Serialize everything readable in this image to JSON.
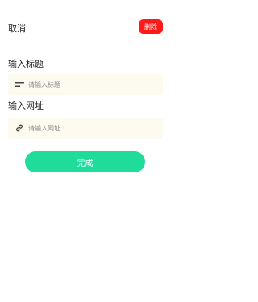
{
  "header": {
    "cancel_label": "取消",
    "delete_label": "删除"
  },
  "title_section": {
    "label": "输入标题",
    "placeholder": "请输入标题",
    "value": ""
  },
  "url_section": {
    "label": "输入网址",
    "placeholder": "请输入网址",
    "value": ""
  },
  "done_label": "完成",
  "colors": {
    "delete_button": "#ff1a1a",
    "done_button": "#1fdc9b",
    "field_background": "#fdfaf0"
  },
  "icons": {
    "title_field": "lines-icon",
    "url_field": "link-icon"
  }
}
